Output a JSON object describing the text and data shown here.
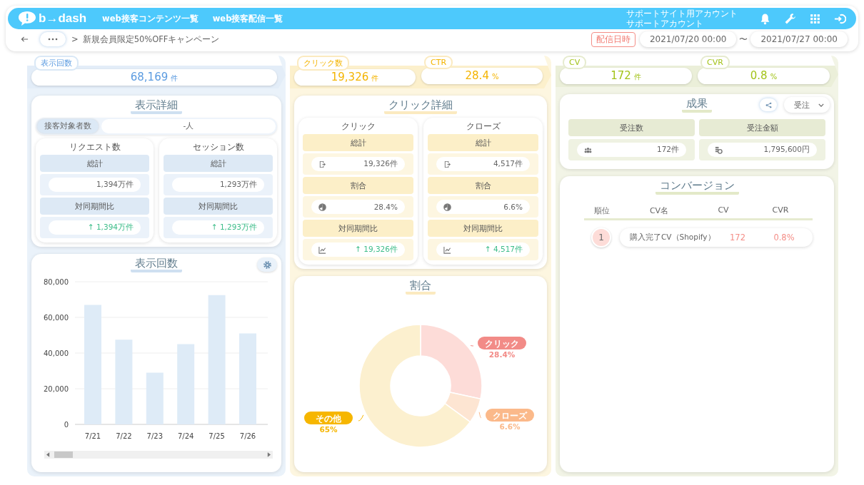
{
  "header": {
    "logo": "b→dash",
    "nav": [
      {
        "label": "web接客コンテンツ一覧"
      },
      {
        "label": "web接客配信一覧"
      }
    ],
    "account": [
      "サポートサイト用アカウント",
      "サポートアカウント"
    ]
  },
  "breadcrumb": {
    "separator": ">",
    "current": "新規会員限定50%OFFキャンペーン"
  },
  "period": {
    "label": "配信日時",
    "start": "2021/07/20 00:00",
    "tilde": "〜",
    "end": "2021/07/27 00:00"
  },
  "impressions": {
    "metrics": [
      {
        "label": "表示回数",
        "value": "68,169",
        "unit": "件"
      }
    ],
    "detail": {
      "title": "表示詳細",
      "target": {
        "label": "接客対象者数",
        "value": "-人"
      },
      "icons": false,
      "groups": [
        {
          "title": "リクエスト数",
          "rows": [
            {
              "kind": "count",
              "header": "総計",
              "value": "1,394万件"
            },
            {
              "kind": "change",
              "header": "対同期間比",
              "value": "↑ 1,394万件"
            }
          ]
        },
        {
          "title": "セッション数",
          "rows": [
            {
              "kind": "count",
              "header": "総計",
              "value": "1,293万件"
            },
            {
              "kind": "change",
              "header": "対同期間比",
              "value": "↑ 1,293万件"
            }
          ]
        }
      ]
    },
    "chart": {
      "title": "表示回数",
      "chart_data": {
        "type": "bar",
        "categories": [
          "7/21",
          "7/22",
          "7/23",
          "7/24",
          "7/25",
          "7/26"
        ],
        "series": [
          {
            "color": "#deebf7",
            "values": [
              67000,
              47500,
              29000,
              45000,
              72500,
              51000
            ]
          }
        ],
        "grid": true,
        "ylim": [
          0,
          80000
        ],
        "yticks": [
          {
            "value": 0,
            "label": "0"
          },
          {
            "value": 20000,
            "label": "20,000"
          },
          {
            "value": 40000,
            "label": "40,000"
          },
          {
            "value": 60000,
            "label": "60,000"
          },
          {
            "value": 80000,
            "label": "80,000"
          }
        ]
      }
    }
  },
  "clicks": {
    "metrics": [
      {
        "label": "クリック数",
        "value": "19,326",
        "unit": "件"
      },
      {
        "label": "CTR",
        "value": "28.4",
        "unit": "%"
      }
    ],
    "detail": {
      "title": "クリック詳細",
      "icons": true,
      "groups": [
        {
          "title": "クリック",
          "rows": [
            {
              "kind": "count",
              "header": "総計",
              "value": "19,326件"
            },
            {
              "kind": "ratio",
              "header": "割合",
              "value": "28.4%"
            },
            {
              "kind": "change",
              "header": "対同期間比",
              "value": "↑ 19,326件"
            }
          ]
        },
        {
          "title": "クローズ",
          "rows": [
            {
              "kind": "count",
              "header": "総計",
              "value": "4,517件"
            },
            {
              "kind": "ratio",
              "header": "割合",
              "value": "6.6%"
            },
            {
              "kind": "change",
              "header": "対同期間比",
              "value": "↑ 4,517件"
            }
          ]
        }
      ]
    },
    "ratio": {
      "title": "割合",
      "chart_data": {
        "type": "donut",
        "categories": [
          "クリック",
          "クローズ",
          "その他"
        ],
        "values": [
          28.4,
          6.6,
          65
        ],
        "value_labels": [
          "28.4%",
          "6.6%",
          "65%"
        ]
      }
    }
  },
  "results": {
    "metrics": [
      {
        "label": "CV",
        "value": "172",
        "unit": "件"
      },
      {
        "label": "CVR",
        "value": "0.8",
        "unit": "%"
      }
    ],
    "outcome": {
      "title": "成果",
      "filter": "受注",
      "items": [
        {
          "kind": "count",
          "label": "受注数",
          "value": "172件"
        },
        {
          "kind": "amount",
          "label": "受注金額",
          "value": "1,795,600円"
        }
      ]
    },
    "conversions": {
      "title": "コンバージョン",
      "columns": [
        "順位",
        "CV名",
        "CV",
        "CVR"
      ],
      "rows": [
        {
          "rank": "1",
          "name": "購入完了CV（Shopify）",
          "cv": "172",
          "cvr": "0.8%"
        }
      ]
    }
  }
}
